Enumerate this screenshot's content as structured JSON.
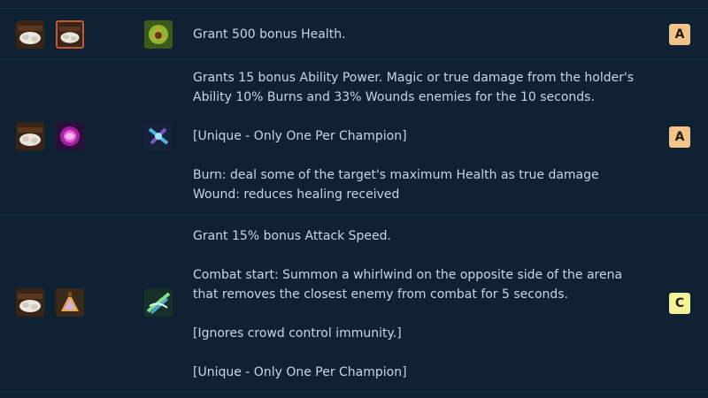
{
  "rows": [
    {
      "description": [
        "Grant 500 bonus Health."
      ],
      "tier": "A",
      "tier_color": "#f3c48a",
      "components": [
        "giants-belt-icon",
        "giants-belt-icon"
      ],
      "result_icon": "warmogs-armor-icon"
    },
    {
      "description": [
        "Grants 15 bonus Ability Power. Magic or true damage from the holder's",
        "Ability 10% Burns and 33% Wounds enemies for the 10 seconds.",
        "",
        "[Unique - Only One Per Champion]",
        "",
        "Burn: deal some of the target's maximum Health as true damage",
        "Wound: reduces healing received"
      ],
      "tier": "A",
      "tier_color": "#f3c48a",
      "components": [
        "giants-belt-icon",
        "magic-orb-icon"
      ],
      "result_icon": "emblem-icon"
    },
    {
      "description": [
        "Grant 15% bonus Attack Speed.",
        "",
        "Combat start: Summon a whirlwind on the opposite side of the arena",
        "that removes the closest enemy from combat for 5 seconds.",
        "",
        "[Ignores crowd control immunity.]",
        "",
        "[Unique - Only One Per Champion]"
      ],
      "tier": "C",
      "tier_color": "#f2f29a",
      "components": [
        "giants-belt-icon",
        "spatula-icon"
      ],
      "result_icon": "zephyr-icon"
    }
  ]
}
